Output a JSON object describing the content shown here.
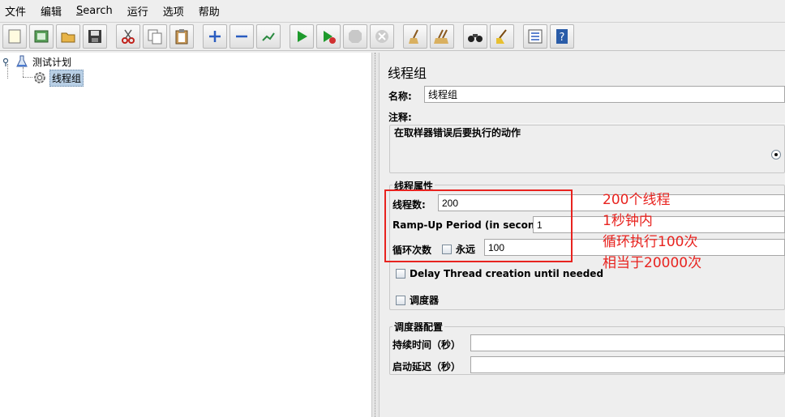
{
  "menu": [
    "文件",
    "编辑",
    "Search",
    "运行",
    "选项",
    "帮助"
  ],
  "toolbar": {
    "buttons": [
      "new-icon",
      "templates-icon",
      "open-icon",
      "save-icon",
      "cut-icon",
      "copy-icon",
      "paste-icon",
      "expand-icon",
      "collapse-icon",
      "toggle-icon",
      "start-icon",
      "start-no-pause-icon",
      "stop-icon",
      "shutdown-icon",
      "clear-icon",
      "clear-all-icon",
      "search-icon",
      "reset-search-icon",
      "function-helper-icon",
      "help-icon"
    ]
  },
  "tree": {
    "root": "测试计划",
    "child": "线程组"
  },
  "panel": {
    "title": "线程组",
    "name_label": "名称:",
    "name_value": "线程组",
    "comment_label": "注释:",
    "error_action_legend": "在取样器错误后要执行的动作",
    "thread_props_legend": "线程属性",
    "threads_label": "线程数:",
    "threads_value": "200",
    "rampup_label": "Ramp-Up Period (in seconds):",
    "rampup_value": "1",
    "loop_label": "循环次数",
    "forever_label": "永远",
    "loop_value": "100",
    "delay_label": "Delay Thread creation until needed",
    "scheduler_label": "调度器",
    "scheduler_config_legend": "调度器配置",
    "duration_label": "持续时间（秒）",
    "startup_delay_label": "启动延迟（秒）"
  },
  "annotation": {
    "lines": [
      "200个线程",
      "1秒钟内",
      "循环执行100次",
      "相当于20000次"
    ],
    "color": "#e8231f"
  }
}
